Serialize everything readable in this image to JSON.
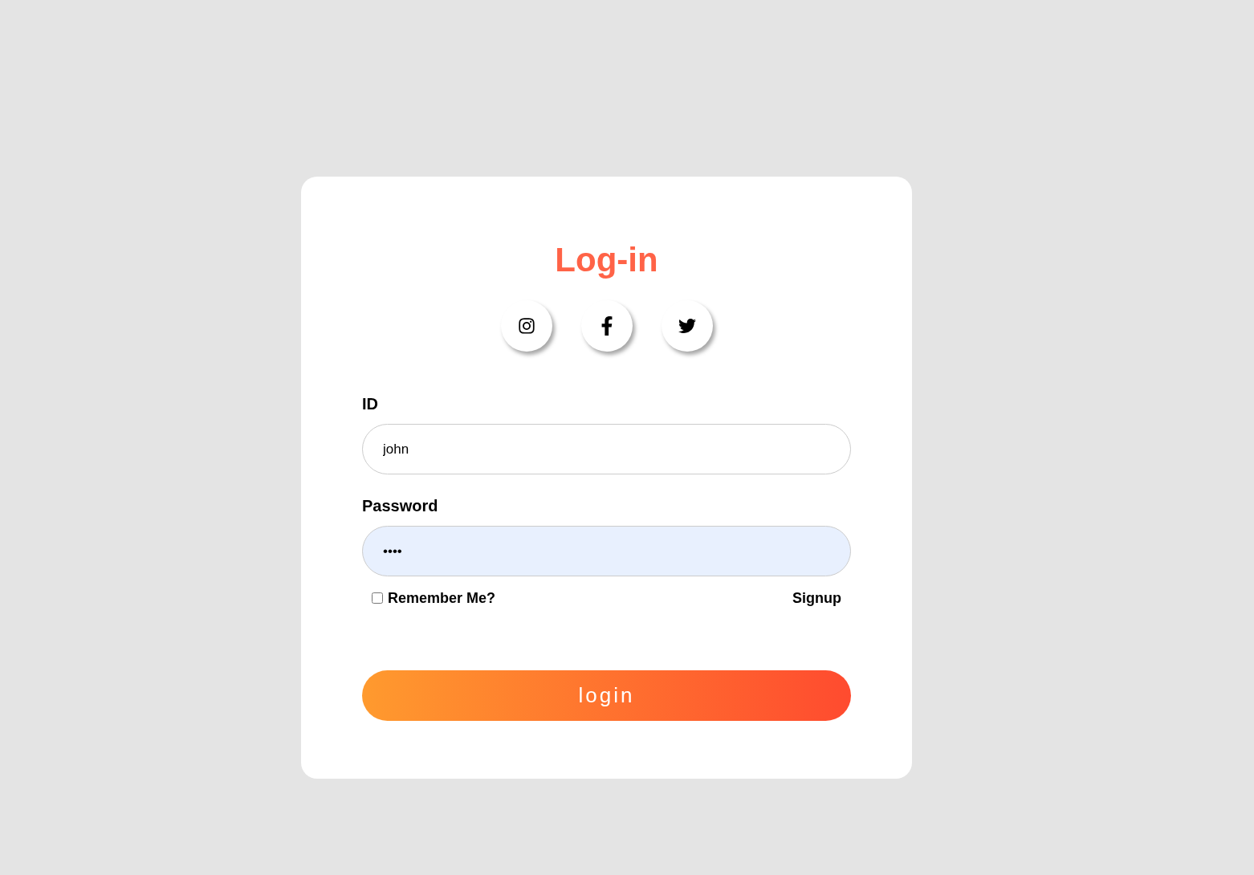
{
  "title": "Log-in",
  "social_buttons": [
    {
      "kind": "instagram"
    },
    {
      "kind": "facebook"
    },
    {
      "kind": "twitter"
    }
  ],
  "fields": [
    {
      "label": "ID",
      "value": "john",
      "autofilled": false
    },
    {
      "label": "Password",
      "value": "••••",
      "autofilled": true
    }
  ],
  "remember": {
    "label": "Remember Me?",
    "checked": false
  },
  "signup_link": "Signup",
  "login_button": "login"
}
